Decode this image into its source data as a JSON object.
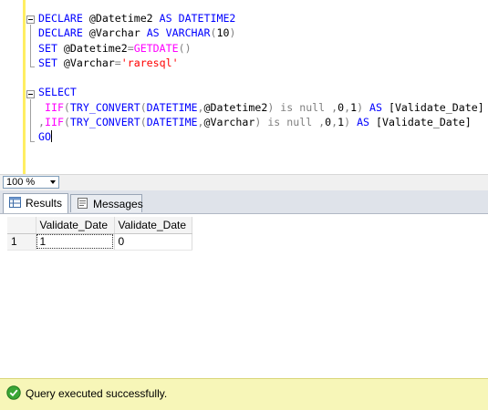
{
  "editor": {
    "lines": [
      {
        "segments": [
          {
            "t": "DECLARE",
            "c": "kw"
          },
          {
            "t": " @Datetime2 ",
            "c": "var"
          },
          {
            "t": "AS",
            "c": "kw"
          },
          {
            "t": " DATETIME2",
            "c": "kw"
          }
        ]
      },
      {
        "segments": [
          {
            "t": "DECLARE",
            "c": "kw"
          },
          {
            "t": " @Varchar ",
            "c": "var"
          },
          {
            "t": "AS",
            "c": "kw"
          },
          {
            "t": " VARCHAR",
            "c": "kw"
          },
          {
            "t": "(",
            "c": "gray"
          },
          {
            "t": "10",
            "c": "var"
          },
          {
            "t": ")",
            "c": "gray"
          }
        ]
      },
      {
        "segments": [
          {
            "t": "SET",
            "c": "kw"
          },
          {
            "t": " @Datetime2",
            "c": "var"
          },
          {
            "t": "=",
            "c": "gray"
          },
          {
            "t": "GETDATE",
            "c": "fn"
          },
          {
            "t": "()",
            "c": "gray"
          }
        ]
      },
      {
        "segments": [
          {
            "t": "SET",
            "c": "kw"
          },
          {
            "t": " @Varchar",
            "c": "var"
          },
          {
            "t": "=",
            "c": "gray"
          },
          {
            "t": "'raresql'",
            "c": "str"
          }
        ]
      },
      {
        "segments": []
      },
      {
        "segments": [
          {
            "t": "SELECT",
            "c": "kw"
          }
        ]
      },
      {
        "segments": [
          {
            "t": " IIF",
            "c": "fn"
          },
          {
            "t": "(",
            "c": "gray"
          },
          {
            "t": "TRY_CONVERT",
            "c": "kw"
          },
          {
            "t": "(",
            "c": "gray"
          },
          {
            "t": "DATETIME",
            "c": "kw"
          },
          {
            "t": ",",
            "c": "gray"
          },
          {
            "t": "@Datetime2",
            "c": "var"
          },
          {
            "t": ")",
            "c": "gray"
          },
          {
            "t": " is null ",
            "c": "gray"
          },
          {
            "t": ",",
            "c": "gray"
          },
          {
            "t": "0",
            "c": "var"
          },
          {
            "t": ",",
            "c": "gray"
          },
          {
            "t": "1",
            "c": "var"
          },
          {
            "t": ")",
            "c": "gray"
          },
          {
            "t": " AS ",
            "c": "kw"
          },
          {
            "t": "[Validate_Date]",
            "c": "br"
          }
        ]
      },
      {
        "segments": [
          {
            "t": ",",
            "c": "gray"
          },
          {
            "t": "IIF",
            "c": "fn"
          },
          {
            "t": "(",
            "c": "gray"
          },
          {
            "t": "TRY_CONVERT",
            "c": "kw"
          },
          {
            "t": "(",
            "c": "gray"
          },
          {
            "t": "DATETIME",
            "c": "kw"
          },
          {
            "t": ",",
            "c": "gray"
          },
          {
            "t": "@Varchar",
            "c": "var"
          },
          {
            "t": ")",
            "c": "gray"
          },
          {
            "t": " is null ",
            "c": "gray"
          },
          {
            "t": ",",
            "c": "gray"
          },
          {
            "t": "0",
            "c": "var"
          },
          {
            "t": ",",
            "c": "gray"
          },
          {
            "t": "1",
            "c": "var"
          },
          {
            "t": ")",
            "c": "gray"
          },
          {
            "t": " AS ",
            "c": "kw"
          },
          {
            "t": "[Validate_Date]",
            "c": "br"
          }
        ]
      },
      {
        "segments": [
          {
            "t": "GO",
            "c": "kw"
          }
        ],
        "caret": true
      }
    ]
  },
  "zoom": {
    "value": "100 %"
  },
  "tabs": [
    {
      "label": "Results",
      "active": true
    },
    {
      "label": "Messages",
      "active": false
    }
  ],
  "grid": {
    "columns": [
      "Validate_Date",
      "Validate_Date"
    ],
    "rows": [
      {
        "num": "1",
        "cells": [
          "1",
          "0"
        ]
      }
    ]
  },
  "status": {
    "text": "Query executed successfully."
  },
  "colors": {
    "keyword": "#0000ff",
    "function": "#ff00ff",
    "string": "#ff0000",
    "operator": "#808080",
    "statusbar": "#f7f6b8"
  }
}
